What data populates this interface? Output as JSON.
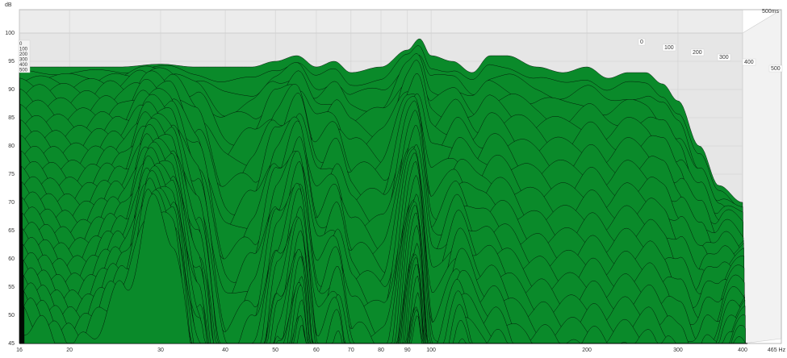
{
  "chart_data": {
    "type": "area",
    "subtype": "waterfall",
    "ylabel": "dB",
    "xlabel": "Hz",
    "ylim": [
      45,
      100
    ],
    "xlim": [
      16,
      465
    ],
    "xscale": "log",
    "y_ticks": [
      "45",
      "50",
      "55",
      "60",
      "65",
      "70",
      "75",
      "80",
      "85",
      "90",
      "95",
      "100"
    ],
    "x_ticks": [
      {
        "v": 16,
        "label": "16"
      },
      {
        "v": 20,
        "label": "20"
      },
      {
        "v": 30,
        "label": "30"
      },
      {
        "v": 40,
        "label": "40"
      },
      {
        "v": 50,
        "label": "50"
      },
      {
        "v": 60,
        "label": "60"
      },
      {
        "v": 70,
        "label": "70"
      },
      {
        "v": 80,
        "label": "80"
      },
      {
        "v": 90,
        "label": "90"
      },
      {
        "v": 100,
        "label": "100"
      },
      {
        "v": 200,
        "label": "200"
      },
      {
        "v": 300,
        "label": "300"
      },
      {
        "v": 400,
        "label": "400"
      },
      {
        "v": 465,
        "label": "465 Hz"
      }
    ],
    "time_axis_label": "500ms",
    "time_ticks": [
      "0",
      "100",
      "200",
      "300",
      "400",
      "500"
    ],
    "legend_times": [
      "0",
      "100",
      "200",
      "300",
      "400",
      "500"
    ],
    "time_range_ms": [
      0,
      500
    ],
    "slice_step_ms": 10,
    "fill_color": "#0a8a2a",
    "stroke_color": "#000000",
    "front_slice": {
      "freq": [
        16,
        20,
        25,
        30,
        35,
        40,
        45,
        50,
        55,
        60,
        65,
        70,
        80,
        90,
        95,
        100,
        110,
        120,
        130,
        140,
        160,
        180,
        200,
        220,
        240,
        260,
        280,
        300,
        330,
        360,
        400
      ],
      "db": [
        94,
        94,
        94,
        94.5,
        94,
        94,
        94,
        95,
        96,
        94,
        95,
        93,
        94,
        97,
        99,
        96,
        95,
        93,
        96,
        96,
        94,
        93,
        94,
        92,
        93,
        93,
        91,
        88,
        80,
        73,
        70
      ]
    },
    "decay_db_per_100ms": {
      "freq": [
        16,
        20,
        25,
        28,
        31,
        35,
        40,
        45,
        50,
        55,
        60,
        65,
        70,
        80,
        92,
        100,
        113,
        130,
        150,
        200,
        300,
        400
      ],
      "db": [
        9,
        10,
        8,
        5,
        6,
        12,
        25,
        22,
        14,
        10,
        18,
        16,
        20,
        22,
        10,
        20,
        15,
        18,
        20,
        20,
        20,
        8
      ]
    }
  }
}
